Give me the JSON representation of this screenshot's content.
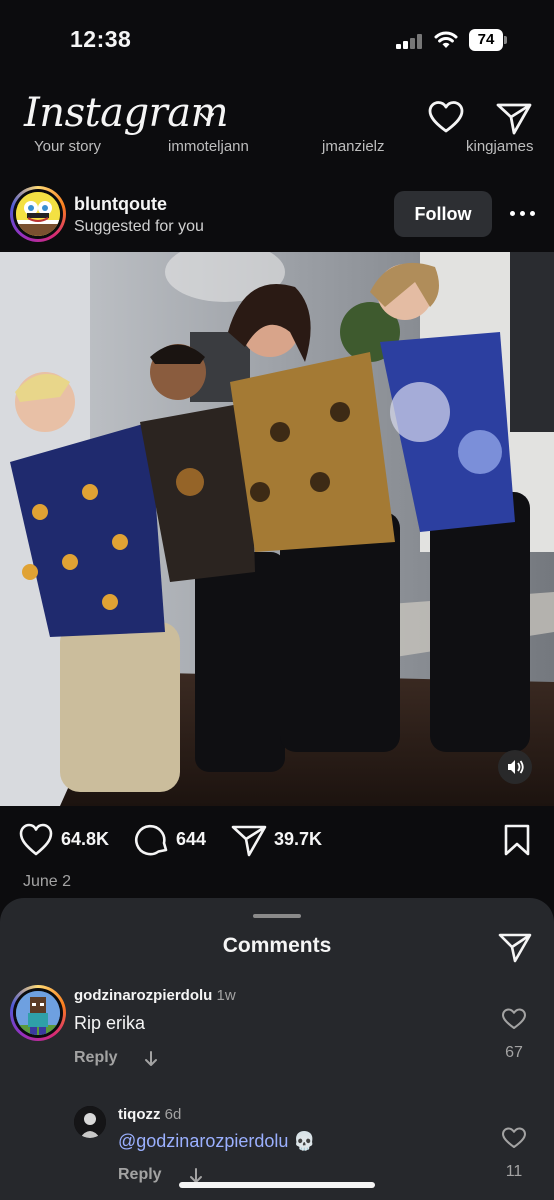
{
  "status_bar": {
    "time": "12:38",
    "battery": "74"
  },
  "header": {
    "logo": "Instagram"
  },
  "stories": [
    "Your story",
    "immoteljann",
    "jmanzielz",
    "kingjames"
  ],
  "post": {
    "username": "bluntqoute",
    "subtitle": "Suggested for you",
    "follow_label": "Follow",
    "likes": "64.8K",
    "comments": "644",
    "shares": "39.7K",
    "date": "June 2"
  },
  "comments_sheet": {
    "title": "Comments",
    "comments": [
      {
        "user": "godzinarozpierdolu",
        "time": "1w",
        "text": "Rip erika",
        "reply": "Reply",
        "likes": "67"
      },
      {
        "user": "tiqozz",
        "time": "6d",
        "mention": "@godzinarozpierdolu",
        "emoji": "💀",
        "reply": "Reply",
        "likes": "11"
      }
    ]
  },
  "icons": {
    "heart": "heart-icon",
    "send": "paper-plane-icon",
    "comment": "speech-bubble-icon",
    "bookmark": "bookmark-icon",
    "more": "more-horizontal-icon",
    "sound": "speaker-icon",
    "chevron": "chevron-down-icon"
  },
  "colors": {
    "background": "#0c0c0e",
    "sheet": "#26282c",
    "follow_button": "#2d2f33",
    "mention": "#9bb0ff"
  }
}
